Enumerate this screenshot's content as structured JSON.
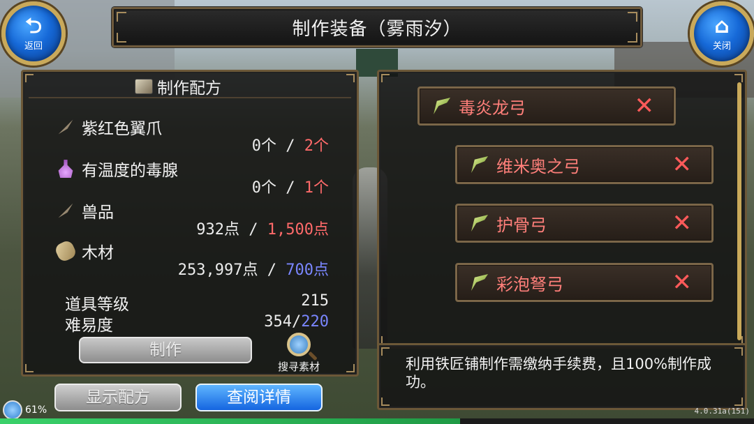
{
  "title": "制作装备（雾雨汐）",
  "back_button": {
    "icon": "back-arrow-icon",
    "label": "返回"
  },
  "close_button": {
    "icon": "home-icon",
    "label": "关闭"
  },
  "recipe": {
    "header": "制作配方",
    "materials": [
      {
        "name": "紫红色翼爪",
        "icon": "claw-icon",
        "have": "0个",
        "sep": " / ",
        "need": "2个",
        "need_color": "#ff6a6a"
      },
      {
        "name": "有温度的毒腺",
        "icon": "potion-icon",
        "have": "0个",
        "sep": " / ",
        "need": "1个",
        "need_color": "#ff6a6a"
      },
      {
        "name": "兽品",
        "icon": "claw-icon",
        "have": "932点",
        "sep": " / ",
        "need": "1,500点",
        "need_color": "#ff6a6a"
      },
      {
        "name": "木材",
        "icon": "wood-icon",
        "have": "253,997点",
        "sep": " / ",
        "need": "700点",
        "need_color": "#7a86ff"
      }
    ],
    "item_level_label": "道具等级",
    "item_level_value": "215",
    "difficulty_label": "难易度",
    "difficulty_value": "354/",
    "difficulty_target": "220",
    "make_button": "制作",
    "search_materials": "搜寻素材"
  },
  "bottom_buttons": {
    "show_recipe": "显示配方",
    "view_detail": "查阅详情"
  },
  "equipment_list": [
    {
      "name": "毒炎龙弓"
    },
    {
      "name": "维米奥之弓"
    },
    {
      "name": "护骨弓"
    },
    {
      "name": "彩泡弩弓"
    }
  ],
  "message": "利用铁匠铺制作需缴纳手续费，且100%制作成功。",
  "status": {
    "battery": "61%",
    "version": "4.0.31a(151)",
    "exp_fill": 0.61
  }
}
